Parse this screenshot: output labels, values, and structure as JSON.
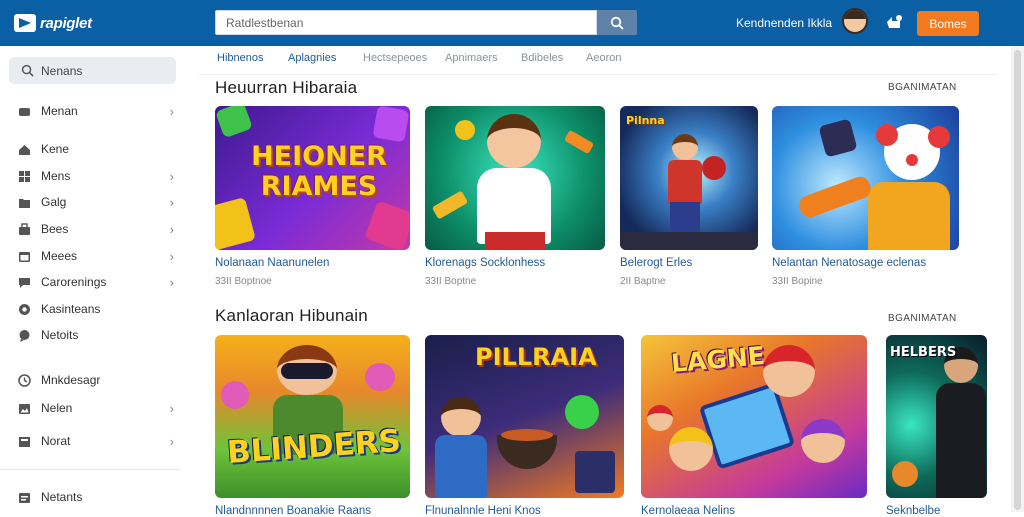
{
  "header": {
    "logo_text": "rapiglet",
    "search_value": "Ratdlestbenan",
    "user_name": "Kendnenden Ikkla",
    "cta_label": "Bomes"
  },
  "sidebar": {
    "search_label": "Nenans",
    "items": [
      {
        "label": "Menan",
        "chevron": true,
        "icon": "gamepad-icon"
      },
      {
        "label": "Kene",
        "chevron": false,
        "icon": "home-icon"
      },
      {
        "label": "Mens",
        "chevron": true,
        "icon": "grid-icon"
      },
      {
        "label": "Galg",
        "chevron": true,
        "icon": "folder-icon"
      },
      {
        "label": "Bees",
        "chevron": true,
        "icon": "bag-icon"
      },
      {
        "label": "Meees",
        "chevron": true,
        "icon": "calendar-icon"
      },
      {
        "label": "Carorenings",
        "chevron": true,
        "icon": "chat-icon"
      },
      {
        "label": "Kasinteans",
        "chevron": false,
        "icon": "globe-icon"
      },
      {
        "label": "Netoits",
        "chevron": false,
        "icon": "bubble-icon"
      },
      {
        "label": "Mnkdesagr",
        "chevron": false,
        "icon": "clock-icon"
      },
      {
        "label": "Nelen",
        "chevron": true,
        "icon": "image-icon"
      },
      {
        "label": "Norat",
        "chevron": true,
        "icon": "box-icon"
      },
      {
        "label": "Netants",
        "chevron": false,
        "icon": "settings-icon"
      }
    ]
  },
  "subnav": [
    "Hibnenos",
    "Aplagnies",
    "Hectsepeoes",
    "Apnimaers",
    "Bdibeles",
    "Aeoron"
  ],
  "sections": [
    {
      "title": "Heuurran Hibaraia",
      "view_all": "BGANIMATAN",
      "cards": [
        {
          "title": "Nolanaan Naanunelen",
          "meta": "33II Boptnoe",
          "thumb_text": "HEIONER RIAMES"
        },
        {
          "title": "Klorenags Socklonhess",
          "meta": "33II Boptne",
          "thumb_text": ""
        },
        {
          "title": "Belerogt Erles",
          "meta": "2II Baptne",
          "thumb_text": "Pilnna"
        },
        {
          "title": "Nelantan Nenatosage eclenas",
          "meta": "33II Bopine",
          "thumb_text": ""
        }
      ]
    },
    {
      "title": "Kanlaoran Hibunain",
      "view_all": "BGANIMATAN",
      "cards": [
        {
          "title": "Nlandnnnnen Boanakie Raans",
          "meta": "",
          "thumb_text": "BLINDERS"
        },
        {
          "title": "Flnunalnnle Heni Knos",
          "meta": "",
          "thumb_text": "PILLRAIA"
        },
        {
          "title": "Kernolaeaa Nelins",
          "meta": "",
          "thumb_text": "LAGNE"
        },
        {
          "title": "Seknbelbe",
          "meta": "",
          "thumb_text": "HELBERS"
        }
      ]
    }
  ],
  "colors": {
    "header": "#0b5fa5",
    "accent": "#f47a20",
    "link": "#1f5b94"
  }
}
